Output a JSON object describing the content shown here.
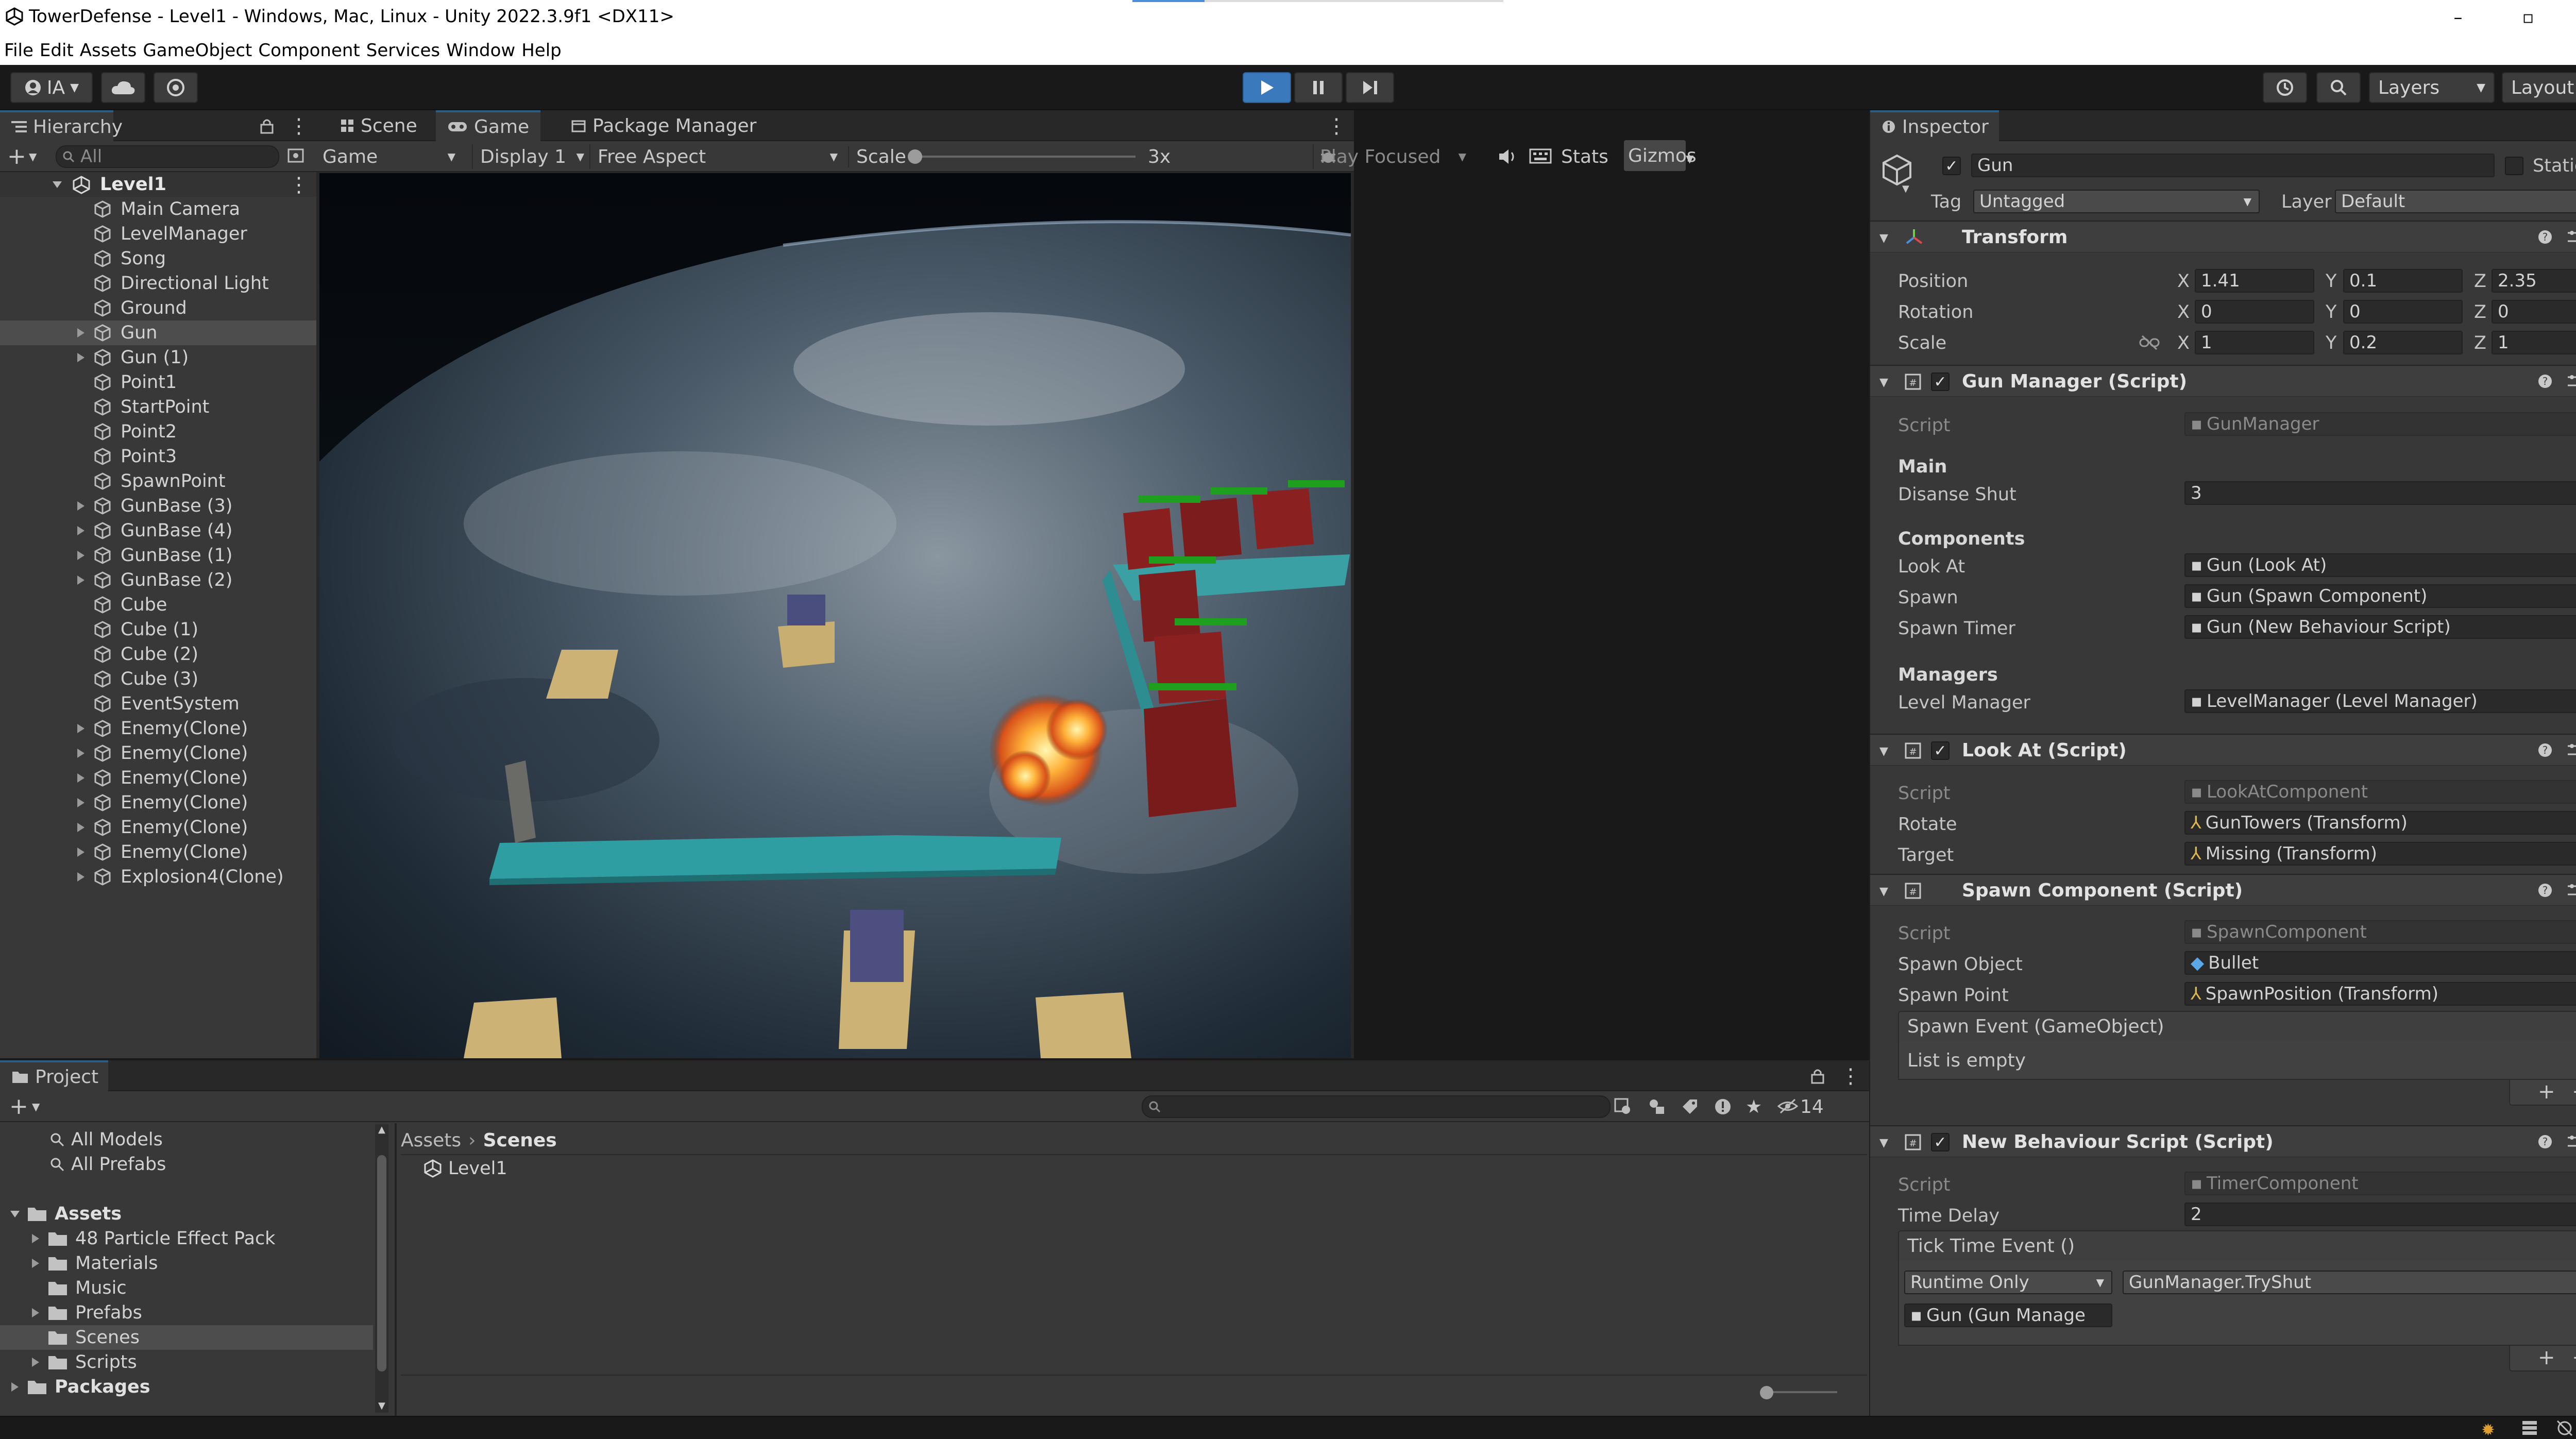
{
  "window": {
    "title": "TowerDefense - Level1 - Windows, Mac, Linux - Unity 2022.3.9f1 <DX11>",
    "controls": [
      "–",
      "▫",
      "✕"
    ]
  },
  "menu": [
    "File",
    "Edit",
    "Assets",
    "GameObject",
    "Component",
    "Services",
    "Window",
    "Help"
  ],
  "toolbar": {
    "account": "IA",
    "layers_label": "Layers",
    "layout_label": "Layout"
  },
  "hierarchy": {
    "tab": "Hierarchy",
    "search_placeholder": "All",
    "scene": "Level1",
    "items": [
      {
        "name": "Main Camera",
        "expandable": false
      },
      {
        "name": "LevelManager",
        "expandable": false
      },
      {
        "name": "Song",
        "expandable": false
      },
      {
        "name": "Directional Light",
        "expandable": false
      },
      {
        "name": "Ground",
        "expandable": false
      },
      {
        "name": "Gun",
        "expandable": true,
        "selected": true
      },
      {
        "name": "Gun (1)",
        "expandable": true
      },
      {
        "name": "Point1",
        "expandable": false
      },
      {
        "name": "StartPoint",
        "expandable": false
      },
      {
        "name": "Point2",
        "expandable": false
      },
      {
        "name": "Point3",
        "expandable": false
      },
      {
        "name": "SpawnPoint",
        "expandable": false
      },
      {
        "name": "GunBase (3)",
        "expandable": true
      },
      {
        "name": "GunBase (4)",
        "expandable": true
      },
      {
        "name": "GunBase (1)",
        "expandable": true
      },
      {
        "name": "GunBase (2)",
        "expandable": true
      },
      {
        "name": "Cube",
        "expandable": false
      },
      {
        "name": "Cube (1)",
        "expandable": false
      },
      {
        "name": "Cube (2)",
        "expandable": false
      },
      {
        "name": "Cube (3)",
        "expandable": false
      },
      {
        "name": "EventSystem",
        "expandable": false
      },
      {
        "name": "Enemy(Clone)",
        "expandable": true
      },
      {
        "name": "Enemy(Clone)",
        "expandable": true
      },
      {
        "name": "Enemy(Clone)",
        "expandable": true
      },
      {
        "name": "Enemy(Clone)",
        "expandable": true
      },
      {
        "name": "Enemy(Clone)",
        "expandable": true
      },
      {
        "name": "Enemy(Clone)",
        "expandable": true
      },
      {
        "name": "Explosion4(Clone)",
        "expandable": true
      }
    ]
  },
  "game_view": {
    "tabs": [
      "Scene",
      "Game",
      "Package Manager"
    ],
    "view_select": "Game",
    "display": "Display 1",
    "aspect": "Free Aspect",
    "scale_label": "Scale",
    "scale_value": "3x",
    "play_mode": "Play Focused",
    "stats": "Stats",
    "gizmos": "Gizmos"
  },
  "inspector": {
    "tab": "Inspector",
    "object_name": "Gun",
    "static_label": "Static",
    "tag_label": "Tag",
    "tag_value": "Untagged",
    "layer_label": "Layer",
    "layer_value": "Default",
    "transform": {
      "title": "Transform",
      "position_label": "Position",
      "rotation_label": "Rotation",
      "scale_label": "Scale",
      "position": {
        "x": "1.41",
        "y": "0.1",
        "z": "2.35"
      },
      "rotation": {
        "x": "0",
        "y": "0",
        "z": "0"
      },
      "scale": {
        "x": "1",
        "y": "0.2",
        "z": "1"
      },
      "axis_x": "X",
      "axis_y": "Y",
      "axis_z": "Z"
    },
    "gun_manager": {
      "title": "Gun Manager (Script)",
      "script_label": "Script",
      "script_value": "GunManager",
      "main_header": "Main",
      "disanse_label": "Disanse Shut",
      "disanse_value": "3",
      "components_header": "Components",
      "look_at_label": "Look At",
      "look_at_value": "Gun (Look At)",
      "spawn_label": "Spawn",
      "spawn_value": "Gun (Spawn Component)",
      "spawn_timer_label": "Spawn Timer",
      "spawn_timer_value": "Gun (New Behaviour Script)",
      "managers_header": "Managers",
      "level_manager_label": "Level Manager",
      "level_manager_value": "LevelManager (Level Manager)"
    },
    "look_at": {
      "title": "Look At (Script)",
      "script_label": "Script",
      "script_value": "LookAtComponent",
      "rotate_label": "Rotate",
      "rotate_value": "GunTowers (Transform)",
      "target_label": "Target",
      "target_value": "Missing (Transform)"
    },
    "spawn_component": {
      "title": "Spawn Component (Script)",
      "script_label": "Script",
      "script_value": "SpawnComponent",
      "object_label": "Spawn Object",
      "object_value": "Bullet",
      "point_label": "Spawn Point",
      "point_value": "SpawnPosition (Transform)",
      "event_label": "Spawn Event (GameObject)",
      "empty_text": "List is empty"
    },
    "new_behaviour": {
      "title": "New Behaviour Script (Script)",
      "script_label": "Script",
      "script_value": "TimerComponent",
      "delay_label": "Time Delay",
      "delay_value": "2",
      "event_label": "Tick Time Event ()",
      "runtime": "Runtime Only",
      "method": "GunManager.TryShut",
      "target": "Gun (Gun Manage"
    }
  },
  "project": {
    "tab": "Project",
    "badge_count": "14",
    "favorites": [
      "All Models",
      "All Prefabs"
    ],
    "tree": [
      {
        "name": "Assets",
        "level": 0,
        "expanded": true,
        "bold": true
      },
      {
        "name": "48 Particle Effect Pack",
        "level": 1,
        "expandable": true
      },
      {
        "name": "Materials",
        "level": 1,
        "expandable": true
      },
      {
        "name": "Music",
        "level": 1,
        "expandable": false
      },
      {
        "name": "Prefabs",
        "level": 1,
        "expandable": true
      },
      {
        "name": "Scenes",
        "level": 1,
        "expandable": false,
        "selected": true
      },
      {
        "name": "Scripts",
        "level": 1,
        "expandable": true
      },
      {
        "name": "Packages",
        "level": 0,
        "expandable": true,
        "bold": true
      }
    ],
    "breadcrumb": [
      "Assets",
      "Scenes"
    ],
    "files": [
      "Level1"
    ]
  }
}
